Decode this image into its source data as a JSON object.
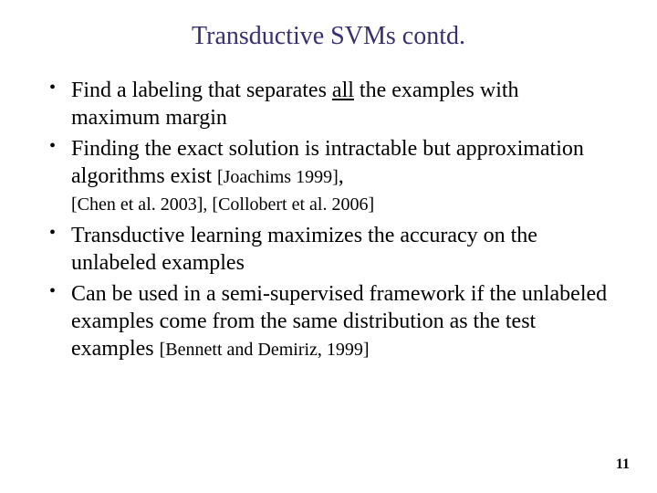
{
  "title": "Transductive SVMs contd.",
  "bullets": {
    "b1_pre": "Find a labeling that separates ",
    "b1_underline": "all",
    "b1_post": " the examples with maximum margin",
    "b2_text": "Finding the exact solution is intractable but approximation algorithms exist ",
    "b2_cite_inline": "[Joachims 1999]",
    "b2_cite_comma": ",",
    "b2_cites_block": "[Chen et al. 2003], [Collobert et al. 2006]",
    "b3": "Transductive learning maximizes the accuracy on the unlabeled examples",
    "b4_text": "Can be used in a semi-supervised framework if the unlabeled examples come from the same distribution as the test examples  ",
    "b4_cite_inline": "[Bennett and Demiriz, 1999]"
  },
  "page_number": "11"
}
